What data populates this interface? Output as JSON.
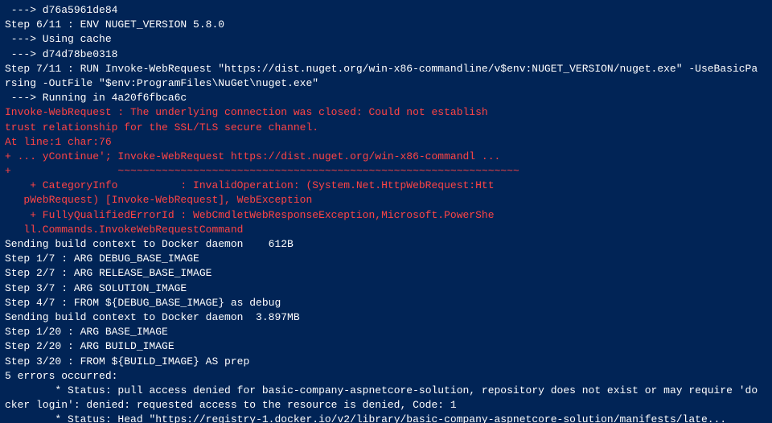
{
  "terminal": {
    "lines": [
      {
        "text": " ---> d76a5961de84",
        "color": "white"
      },
      {
        "text": "Step 6/11 : ENV NUGET_VERSION 5.8.0",
        "color": "white"
      },
      {
        "text": " ---> Using cache",
        "color": "white"
      },
      {
        "text": " ---> d74d78be0318",
        "color": "white"
      },
      {
        "text": "Step 7/11 : RUN Invoke-WebRequest \"https://dist.nuget.org/win-x86-commandline/v$env:NUGET_VERSION/nuget.exe\" -UseBasicPa",
        "color": "white"
      },
      {
        "text": "rsing -OutFile \"$env:ProgramFiles\\NuGet\\nuget.exe\"",
        "color": "white"
      },
      {
        "text": " ---> Running in 4a20f6fbca6c",
        "color": "white"
      },
      {
        "text": "Invoke-WebRequest : The underlying connection was closed: Could not establish",
        "color": "red"
      },
      {
        "text": "trust relationship for the SSL/TLS secure channel.",
        "color": "red"
      },
      {
        "text": "At line:1 char:76",
        "color": "red"
      },
      {
        "text": "+ ... yContinue'; Invoke-WebRequest https://dist.nuget.org/win-x86-commandl ...",
        "color": "red"
      },
      {
        "text": "+                 ~~~~~~~~~~~~~~~~~~~~~~~~~~~~~~~~~~~~~~~~~~~~~~~~~~~~~~~~~~~~~~~~",
        "color": "red"
      },
      {
        "text": "    + CategoryInfo          : InvalidOperation: (System.Net.HttpWebRequest:Htt",
        "color": "red"
      },
      {
        "text": "   pWebRequest) [Invoke-WebRequest], WebException",
        "color": "red"
      },
      {
        "text": "    + FullyQualifiedErrorId : WebCmdletWebResponseException,Microsoft.PowerShe",
        "color": "red"
      },
      {
        "text": "   ll.Commands.InvokeWebRequestCommand",
        "color": "red"
      },
      {
        "text": "",
        "color": "white"
      },
      {
        "text": "Sending build context to Docker daemon    612B",
        "color": "white"
      },
      {
        "text": "Step 1/7 : ARG DEBUG_BASE_IMAGE",
        "color": "white"
      },
      {
        "text": "Step 2/7 : ARG RELEASE_BASE_IMAGE",
        "color": "white"
      },
      {
        "text": "Step 3/7 : ARG SOLUTION_IMAGE",
        "color": "white"
      },
      {
        "text": "Step 4/7 : FROM ${DEBUG_BASE_IMAGE} as debug",
        "color": "white"
      },
      {
        "text": "Sending build context to Docker daemon  3.897MB",
        "color": "white"
      },
      {
        "text": "Step 1/20 : ARG BASE_IMAGE",
        "color": "white"
      },
      {
        "text": "Step 2/20 : ARG BUILD_IMAGE",
        "color": "white"
      },
      {
        "text": "Step 3/20 : FROM ${BUILD_IMAGE} AS prep",
        "color": "white"
      },
      {
        "text": "5 errors occurred:",
        "color": "white"
      },
      {
        "text": "\t* Status: pull access denied for basic-company-aspnetcore-solution, repository does not exist or may require 'do",
        "color": "white"
      },
      {
        "text": "cker login': denied: requested access to the resource is denied, Code: 1",
        "color": "white"
      },
      {
        "text": "\t* Status: Head \"https://registry-1.docker.io/v2/library/basic-company-aspnetcore-solution/manifests/late...",
        "color": "white"
      }
    ]
  }
}
